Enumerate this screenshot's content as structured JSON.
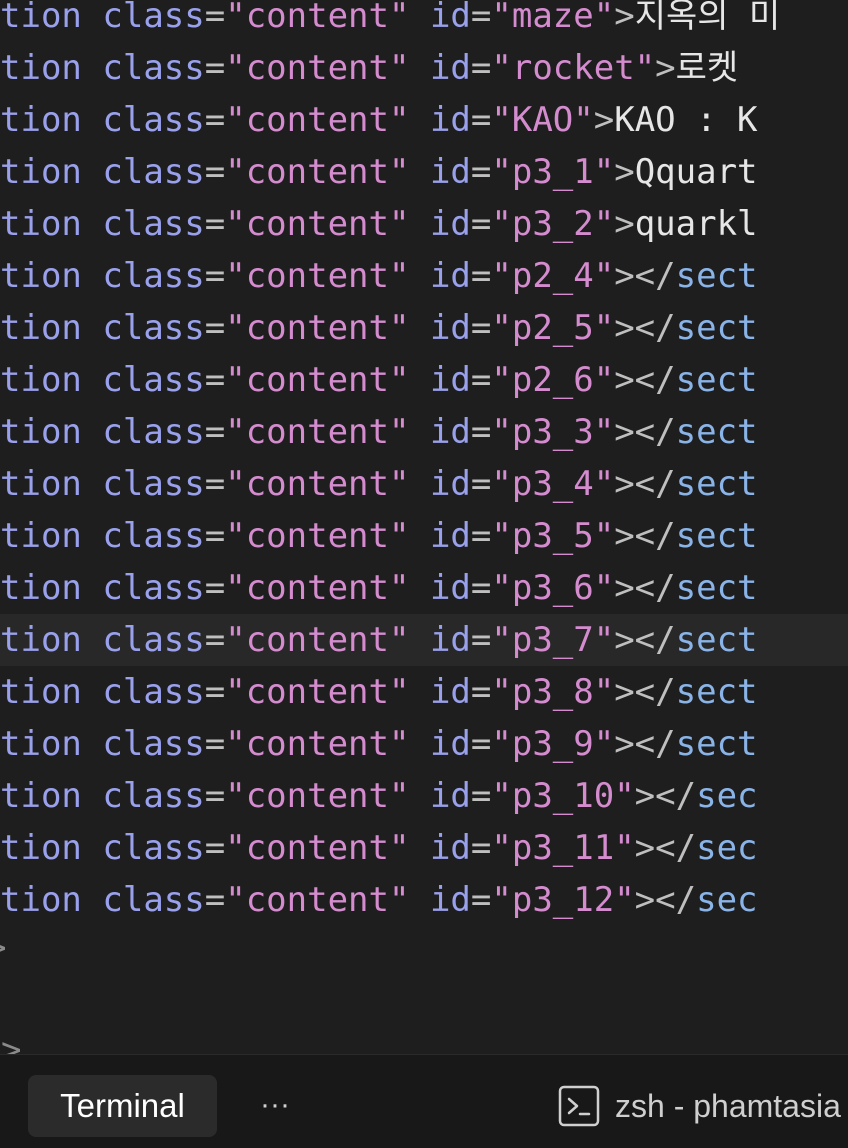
{
  "editor": {
    "lines": [
      {
        "prefix": "tion",
        "attr1": "class",
        "val1": "\"content\"",
        "attr2": "id",
        "val2": "\"maze\"",
        "close": ">",
        "text": "지옥의 미",
        "closing_tag": ""
      },
      {
        "prefix": "tion",
        "attr1": "class",
        "val1": "\"content\"",
        "attr2": "id",
        "val2": "\"rocket\"",
        "close": ">",
        "text": "로켓 ",
        "closing_tag": ""
      },
      {
        "prefix": "tion",
        "attr1": "class",
        "val1": "\"content\"",
        "attr2": "id",
        "val2": "\"KAO\"",
        "close": ">",
        "text": "KAO : K",
        "closing_tag": ""
      },
      {
        "prefix": "tion",
        "attr1": "class",
        "val1": "\"content\"",
        "attr2": "id",
        "val2": "\"p3_1\"",
        "close": ">",
        "text": "Qquart",
        "closing_tag": ""
      },
      {
        "prefix": "tion",
        "attr1": "class",
        "val1": "\"content\"",
        "attr2": "id",
        "val2": "\"p3_2\"",
        "close": ">",
        "text": "quarkl",
        "closing_tag": ""
      },
      {
        "prefix": "tion",
        "attr1": "class",
        "val1": "\"content\"",
        "attr2": "id",
        "val2": "\"p2_4\"",
        "close": "></",
        "text": "",
        "closing_tag": "sect"
      },
      {
        "prefix": "tion",
        "attr1": "class",
        "val1": "\"content\"",
        "attr2": "id",
        "val2": "\"p2_5\"",
        "close": "></",
        "text": "",
        "closing_tag": "sect"
      },
      {
        "prefix": "tion",
        "attr1": "class",
        "val1": "\"content\"",
        "attr2": "id",
        "val2": "\"p2_6\"",
        "close": "></",
        "text": "",
        "closing_tag": "sect"
      },
      {
        "prefix": "tion",
        "attr1": "class",
        "val1": "\"content\"",
        "attr2": "id",
        "val2": "\"p3_3\"",
        "close": "></",
        "text": "",
        "closing_tag": "sect"
      },
      {
        "prefix": "tion",
        "attr1": "class",
        "val1": "\"content\"",
        "attr2": "id",
        "val2": "\"p3_4\"",
        "close": "></",
        "text": "",
        "closing_tag": "sect"
      },
      {
        "prefix": "tion",
        "attr1": "class",
        "val1": "\"content\"",
        "attr2": "id",
        "val2": "\"p3_5\"",
        "close": "></",
        "text": "",
        "closing_tag": "sect"
      },
      {
        "prefix": "tion",
        "attr1": "class",
        "val1": "\"content\"",
        "attr2": "id",
        "val2": "\"p3_6\"",
        "close": "></",
        "text": "",
        "closing_tag": "sect"
      },
      {
        "prefix": "tion",
        "attr1": "class",
        "val1": "\"content\"",
        "attr2": "id",
        "val2": "\"p3_7\"",
        "close": "></",
        "text": "",
        "closing_tag": "sect"
      },
      {
        "prefix": "tion",
        "attr1": "class",
        "val1": "\"content\"",
        "attr2": "id",
        "val2": "\"p3_8\"",
        "close": "></",
        "text": "",
        "closing_tag": "sect"
      },
      {
        "prefix": "tion",
        "attr1": "class",
        "val1": "\"content\"",
        "attr2": "id",
        "val2": "\"p3_9\"",
        "close": "></",
        "text": "",
        "closing_tag": "sect"
      },
      {
        "prefix": "tion",
        "attr1": "class",
        "val1": "\"content\"",
        "attr2": "id",
        "val2": "\"p3_10\"",
        "close": "></",
        "text": "",
        "closing_tag": "sec"
      },
      {
        "prefix": "tion",
        "attr1": "class",
        "val1": "\"content\"",
        "attr2": "id",
        "val2": "\"p3_11\"",
        "close": "></",
        "text": "",
        "closing_tag": "sec"
      },
      {
        "prefix": "tion",
        "attr1": "class",
        "val1": "\"content\"",
        "attr2": "id",
        "val2": "\"p3_12\"",
        "close": "></",
        "text": "",
        "closing_tag": "sec"
      }
    ],
    "trailing_1": ">",
    "trailing_2": "-->"
  },
  "panel": {
    "active_tab": "Terminal",
    "more_label": "···",
    "terminal_label": "zsh - phamtasia",
    "terminal_icon": "terminal-icon"
  },
  "colors": {
    "background": "#1e1e1e",
    "attribute": "#9aa1ec",
    "string": "#d48ccf",
    "tag": "#8ab4e8",
    "text": "#e6e6e6"
  }
}
